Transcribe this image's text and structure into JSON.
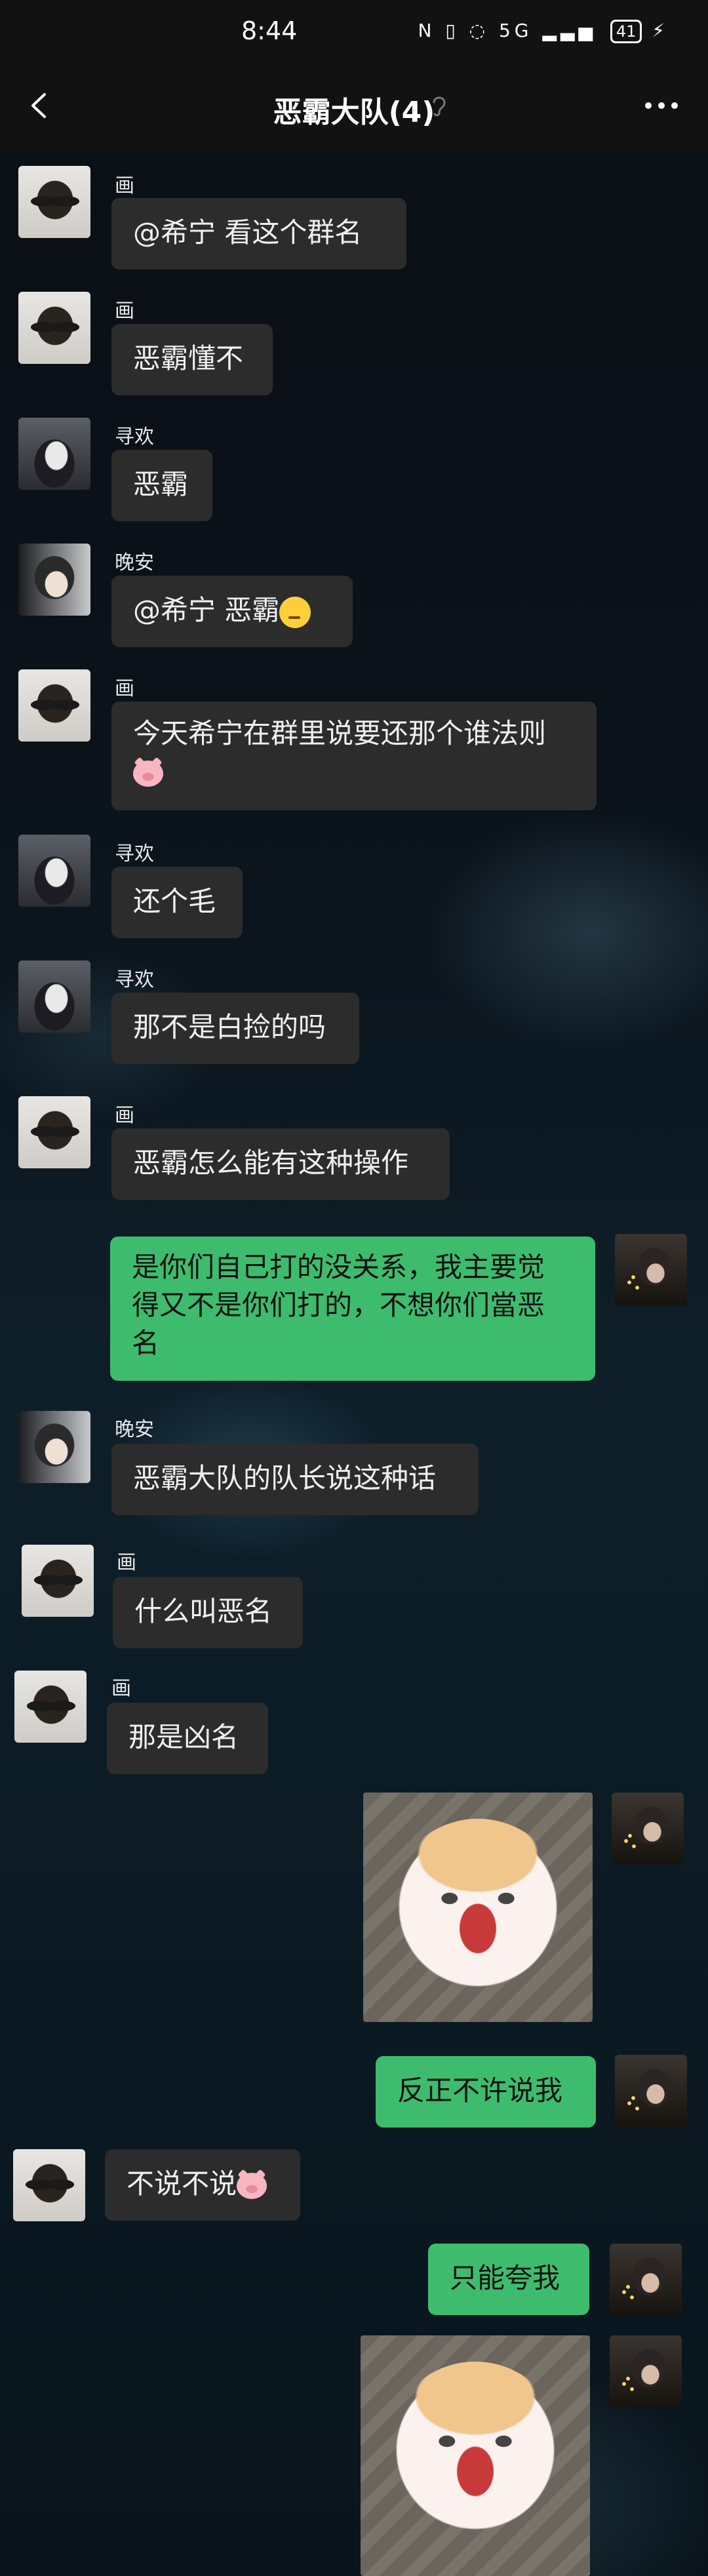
{
  "status_bar": {
    "time": "8:44",
    "icons": "N ▯ ◌ 5G ▂▃▅",
    "battery": "41"
  },
  "header": {
    "title": "恶霸大队(4)"
  },
  "messages": [
    {
      "sender": "画",
      "text": "@希宁  看这个群名"
    },
    {
      "sender": "画",
      "text": "恶霸懂不"
    },
    {
      "sender": "寻欢",
      "text": "恶霸"
    },
    {
      "sender": "晚安",
      "text": "@希宁  恶霸"
    },
    {
      "sender": "画",
      "text_line1": "今天希宁在群里说要还那个谁法则"
    },
    {
      "sender": "寻欢",
      "text": "还个毛"
    },
    {
      "sender": "寻欢",
      "text": "那不是白捡的吗"
    },
    {
      "sender": "画",
      "text": "恶霸怎么能有这种操作"
    },
    {
      "sender": "me",
      "line1": "是你们自己打的没关系，我主要觉",
      "line2": "得又不是你们打的，不想你们當恶",
      "line3": "名"
    },
    {
      "sender": "晚安",
      "text": "恶霸大队的队长说这种话"
    },
    {
      "sender": "画",
      "text": "什么叫恶名"
    },
    {
      "sender": "画",
      "text": "那是凶名"
    },
    {
      "sender": "me",
      "type": "sticker"
    },
    {
      "sender": "me",
      "text": "反正不许说我"
    },
    {
      "sender": "画",
      "text": "不说不说"
    },
    {
      "sender": "me",
      "text": "只能夸我"
    },
    {
      "sender": "me",
      "type": "sticker"
    }
  ],
  "icons": {
    "back": "back-arrow-icon",
    "ear": "ear-icon",
    "more": "more-dots-icon"
  }
}
